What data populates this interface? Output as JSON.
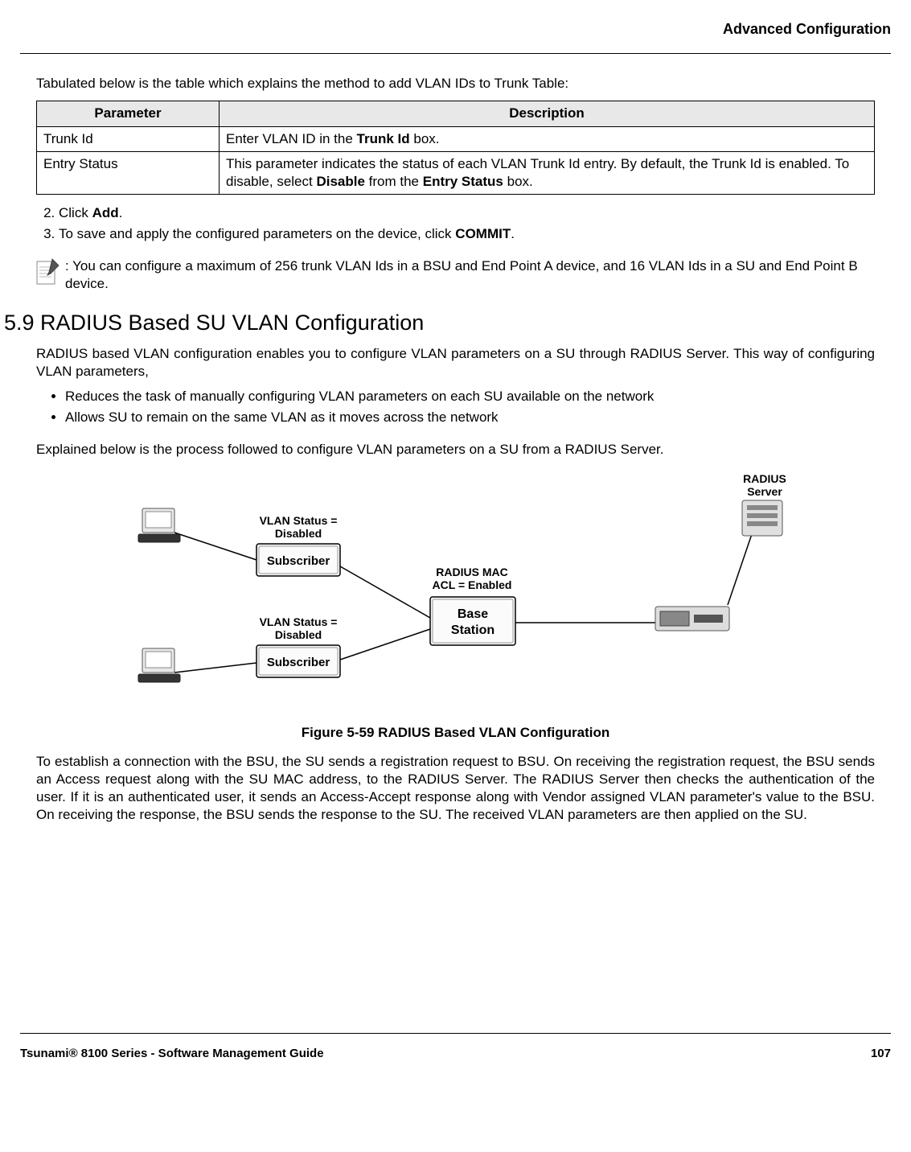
{
  "header": {
    "title": "Advanced Configuration"
  },
  "intro_text": "Tabulated below is the table which explains the method to add VLAN IDs to Trunk Table:",
  "table": {
    "headers": [
      "Parameter",
      "Description"
    ],
    "rows": [
      {
        "param": "Trunk Id",
        "desc_prefix": "Enter VLAN ID in the ",
        "desc_bold": "Trunk Id",
        "desc_suffix": " box."
      },
      {
        "param": "Entry Status",
        "desc_prefix": "This parameter indicates the status of each VLAN Trunk Id entry. By default, the Trunk Id is enabled. To disable, select ",
        "desc_bold": "Disable",
        "desc_mid": " from the ",
        "desc_bold2": "Entry Status",
        "desc_suffix": " box."
      }
    ]
  },
  "steps": {
    "s2_prefix": "Click ",
    "s2_bold": "Add",
    "s2_suffix": ".",
    "s3_prefix": "To save and apply the configured parameters on the device, click ",
    "s3_bold": "COMMIT",
    "s3_suffix": "."
  },
  "note": ": You can configure a maximum of 256 trunk VLAN Ids in a BSU and End Point A device, and 16 VLAN Ids in a SU and End Point B device.",
  "section_heading": "5.9 RADIUS Based SU VLAN Configuration",
  "section_para": "RADIUS based VLAN configuration enables you to configure VLAN parameters on a SU through RADIUS Server. This way of configuring VLAN parameters,",
  "bullets": [
    "Reduces the task of manually configuring VLAN parameters on each SU available on the network",
    "Allows SU to remain on the same VLAN as it moves across the network"
  ],
  "process_intro": "Explained below is the process followed to configure VLAN parameters on a SU from a RADIUS Server.",
  "figure": {
    "labels": {
      "radius_server": "RADIUS\nServer",
      "vlan_disabled": "VLAN Status =\nDisabled",
      "subscriber": "Subscriber",
      "radius_mac_acl": "RADIUS MAC\nACL = Enabled",
      "base_station": "Base\nStation"
    },
    "caption": "Figure 5-59 RADIUS Based VLAN Configuration"
  },
  "closing_para": "To establish a connection with the BSU, the SU sends a registration request to BSU. On receiving the registration request, the BSU sends an Access request along with the SU MAC address, to the RADIUS Server. The RADIUS Server then checks the authentication of the user. If it is an authenticated user, it sends an Access-Accept response along with Vendor assigned VLAN parameter's value to the BSU. On receiving the response, the BSU sends the response to the SU. The received VLAN parameters are then applied on the SU.",
  "footer": {
    "left": "Tsunami® 8100 Series - Software Management Guide",
    "right": "107"
  }
}
